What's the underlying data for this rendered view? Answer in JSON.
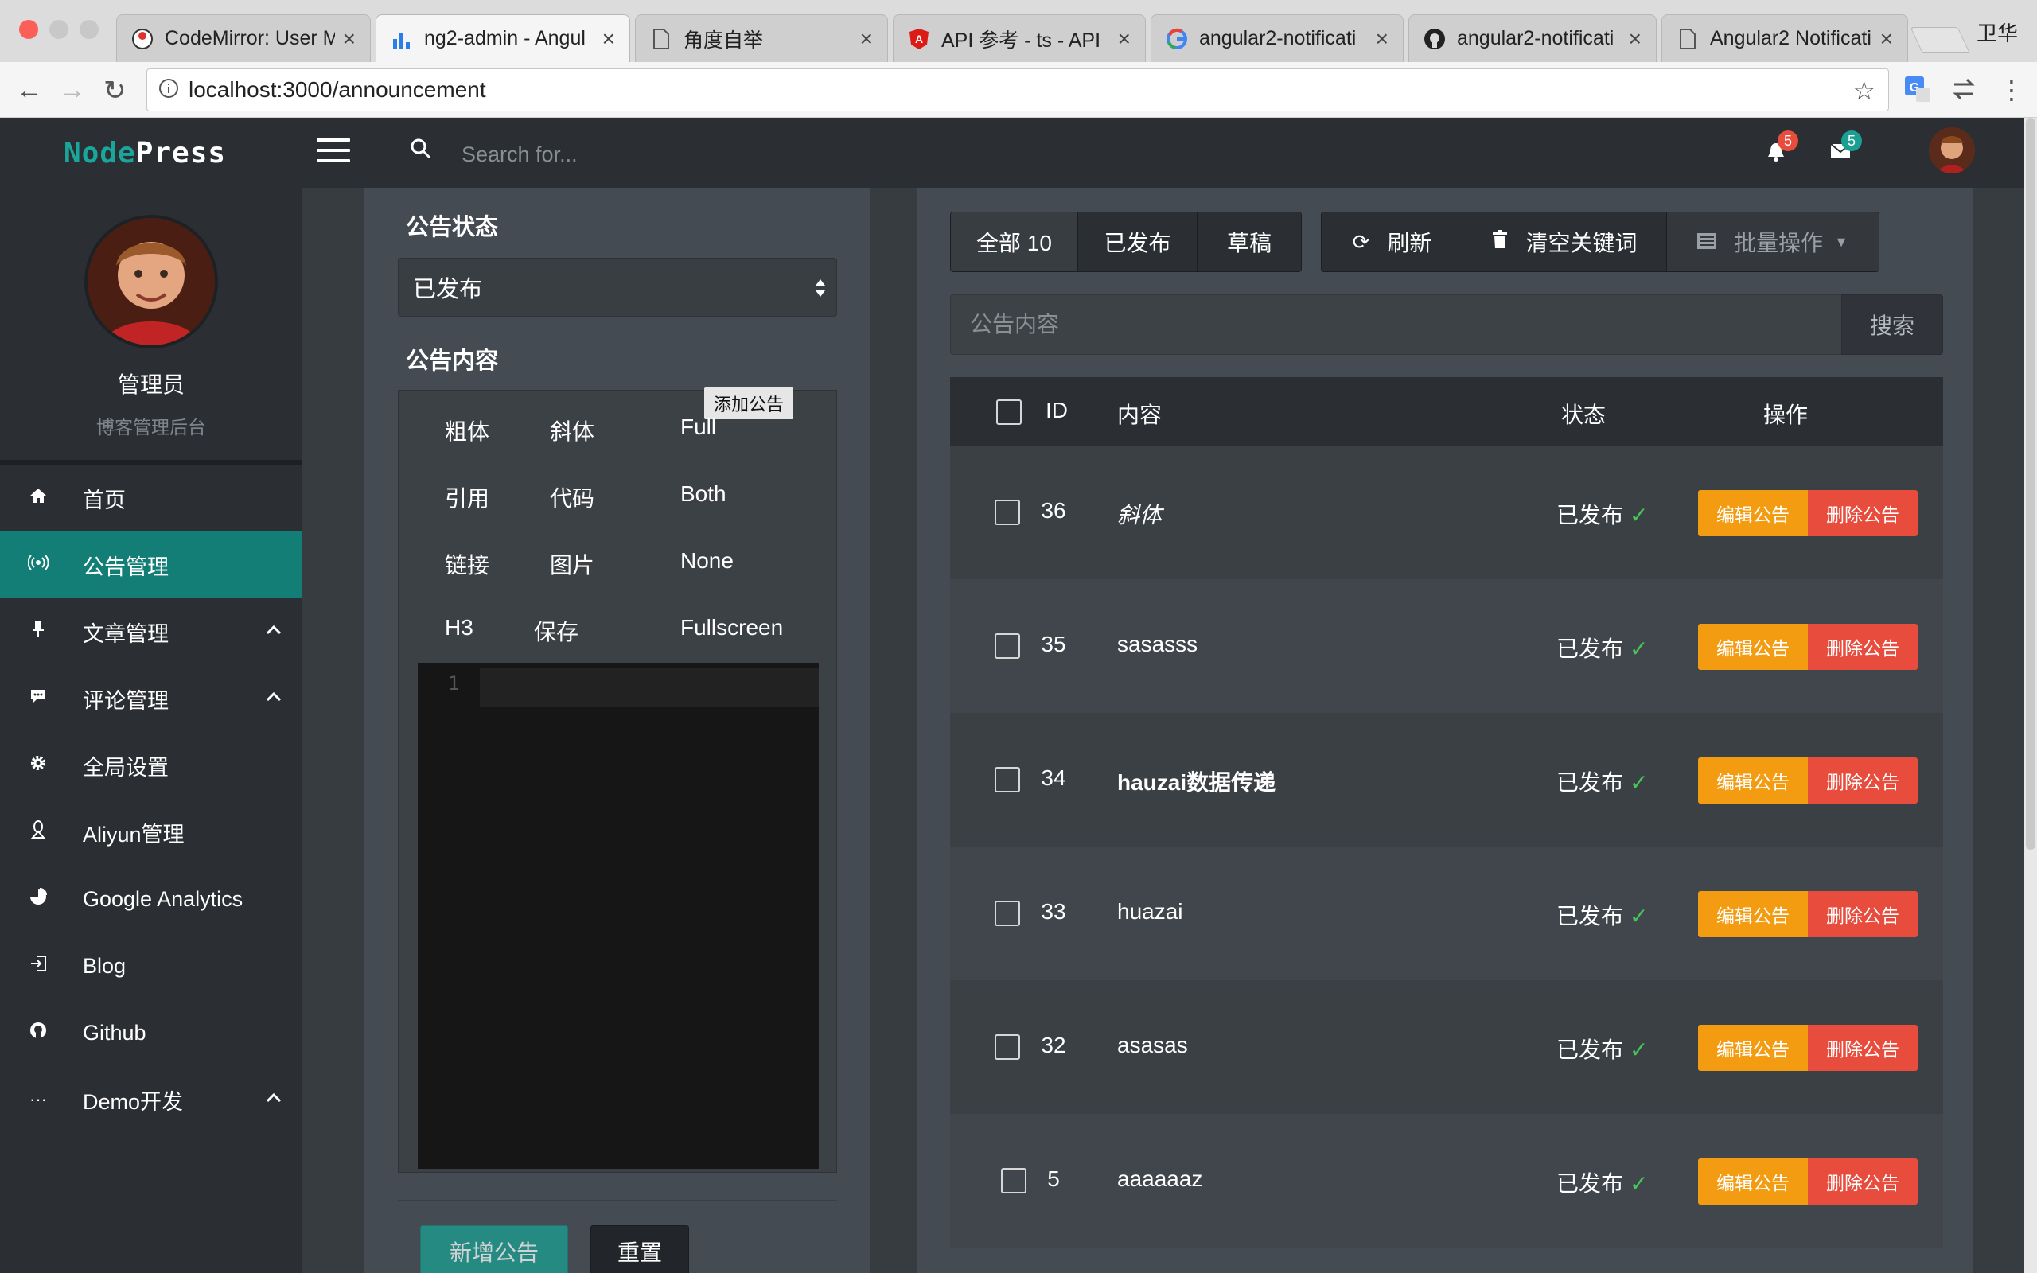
{
  "browser": {
    "tabs": [
      {
        "title": "CodeMirror: User M",
        "icon": "codemirror-icon"
      },
      {
        "title": "ng2-admin - Angul",
        "icon": "bar-chart-icon"
      },
      {
        "title": "角度自举",
        "icon": "document-icon"
      },
      {
        "title": "API 参考 - ts - API",
        "icon": "angular-icon"
      },
      {
        "title": "angular2-notificati",
        "icon": "google-icon"
      },
      {
        "title": "angular2-notificati",
        "icon": "github-icon"
      },
      {
        "title": "Angular2 Notificati",
        "icon": "document-icon"
      }
    ],
    "close_glyph": "×",
    "profile": "卫华",
    "url": "localhost:3000/announcement"
  },
  "header": {
    "logo_part1": "Node",
    "logo_part2": "Press",
    "search_placeholder": "Search for...",
    "notifications_count": "5",
    "messages_count": "5",
    "colors": {
      "notify": "#e74c3c",
      "message": "#1a9f92"
    }
  },
  "sidebar": {
    "user_name": "管理员",
    "user_role": "博客管理后台",
    "items": [
      {
        "label": "首页",
        "icon": "home-icon"
      },
      {
        "label": "公告管理",
        "icon": "broadcast-icon"
      },
      {
        "label": "文章管理",
        "icon": "pin-icon"
      },
      {
        "label": "评论管理",
        "icon": "comment-icon"
      },
      {
        "label": "全局设置",
        "icon": "gear-icon"
      },
      {
        "label": "Aliyun管理",
        "icon": "linux-icon"
      },
      {
        "label": "Google Analytics",
        "icon": "pie-chart-icon"
      },
      {
        "label": "Blog",
        "icon": "sign-in-icon"
      },
      {
        "label": "Github",
        "icon": "github-icon"
      },
      {
        "label": "Demo开发",
        "icon": "ellipsis-icon"
      }
    ],
    "active_color": "#127e76"
  },
  "form": {
    "status_label": "公告状态",
    "status_value": "已发布",
    "content_label": "公告内容",
    "tooltip": "添加公告",
    "toolbar": {
      "bold": "粗体",
      "italic": "斜体",
      "full": "Full",
      "quote": "引用",
      "code": "代码",
      "both": "Both",
      "link": "链接",
      "image": "图片",
      "none": "None",
      "h3": "H3",
      "save": "保存",
      "fullscreen": "Fullscreen"
    },
    "line_number": "1",
    "submit_label": "新增公告",
    "reset_label": "重置"
  },
  "list": {
    "filter_all": "全部 10",
    "filter_published": "已发布",
    "filter_draft": "草稿",
    "refresh_label": "刷新",
    "clear_label": "清空关键词",
    "batch_label": "批量操作",
    "keyword_placeholder": "公告内容",
    "search_button": "搜索",
    "columns": {
      "id": "ID",
      "content": "内容",
      "status": "状态",
      "actions": "操作"
    },
    "rows": [
      {
        "id": "36",
        "content": "斜体",
        "status": "已发布",
        "style": "italic"
      },
      {
        "id": "35",
        "content": "sasasss",
        "status": "已发布",
        "style": "normal"
      },
      {
        "id": "34",
        "content": "hauzai数据传递",
        "status": "已发布",
        "style": "bold"
      },
      {
        "id": "33",
        "content": "huazai",
        "status": "已发布",
        "style": "normal"
      },
      {
        "id": "32",
        "content": "asasas",
        "status": "已发布",
        "style": "normal"
      },
      {
        "id": "5",
        "content": "aaaaaaz",
        "status": "已发布",
        "style": "normal"
      }
    ],
    "edit_label": "编辑公告",
    "delete_label": "删除公告",
    "check_glyph": "✓",
    "colors": {
      "edit": "#f39c12",
      "delete": "#e74c3c",
      "check": "#45c75a"
    }
  }
}
